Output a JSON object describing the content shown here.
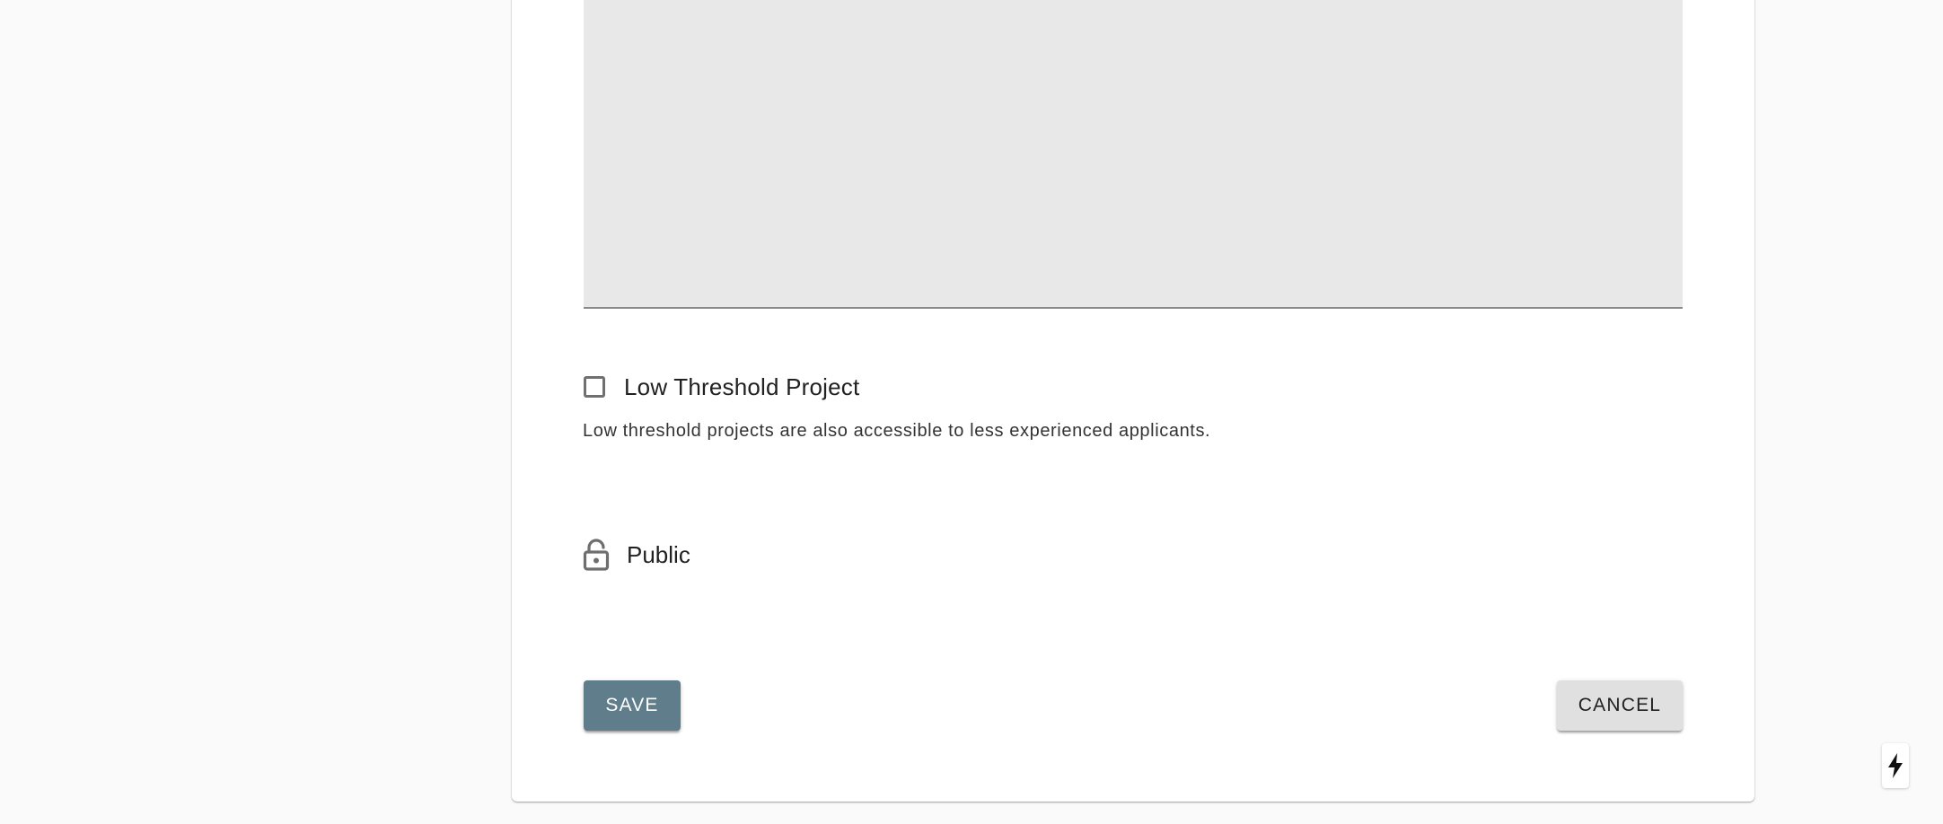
{
  "form": {
    "description_field": {
      "value": ""
    },
    "low_threshold": {
      "label": "Low Threshold Project",
      "checked": false,
      "helper_text": "Low threshold projects are also accessible to less experienced applicants."
    },
    "visibility": {
      "icon": "lock-open-icon",
      "label": "Public"
    },
    "actions": {
      "save_label": "SAVE",
      "cancel_label": "CANCEL"
    }
  },
  "floating_button": {
    "icon": "lightning-bolt-icon"
  },
  "colors": {
    "page_background": "#fafafa",
    "card_background": "#ffffff",
    "textarea_fill": "#e8e8e8",
    "save_button": "#607d8b",
    "cancel_button": "#e0e0e0"
  }
}
